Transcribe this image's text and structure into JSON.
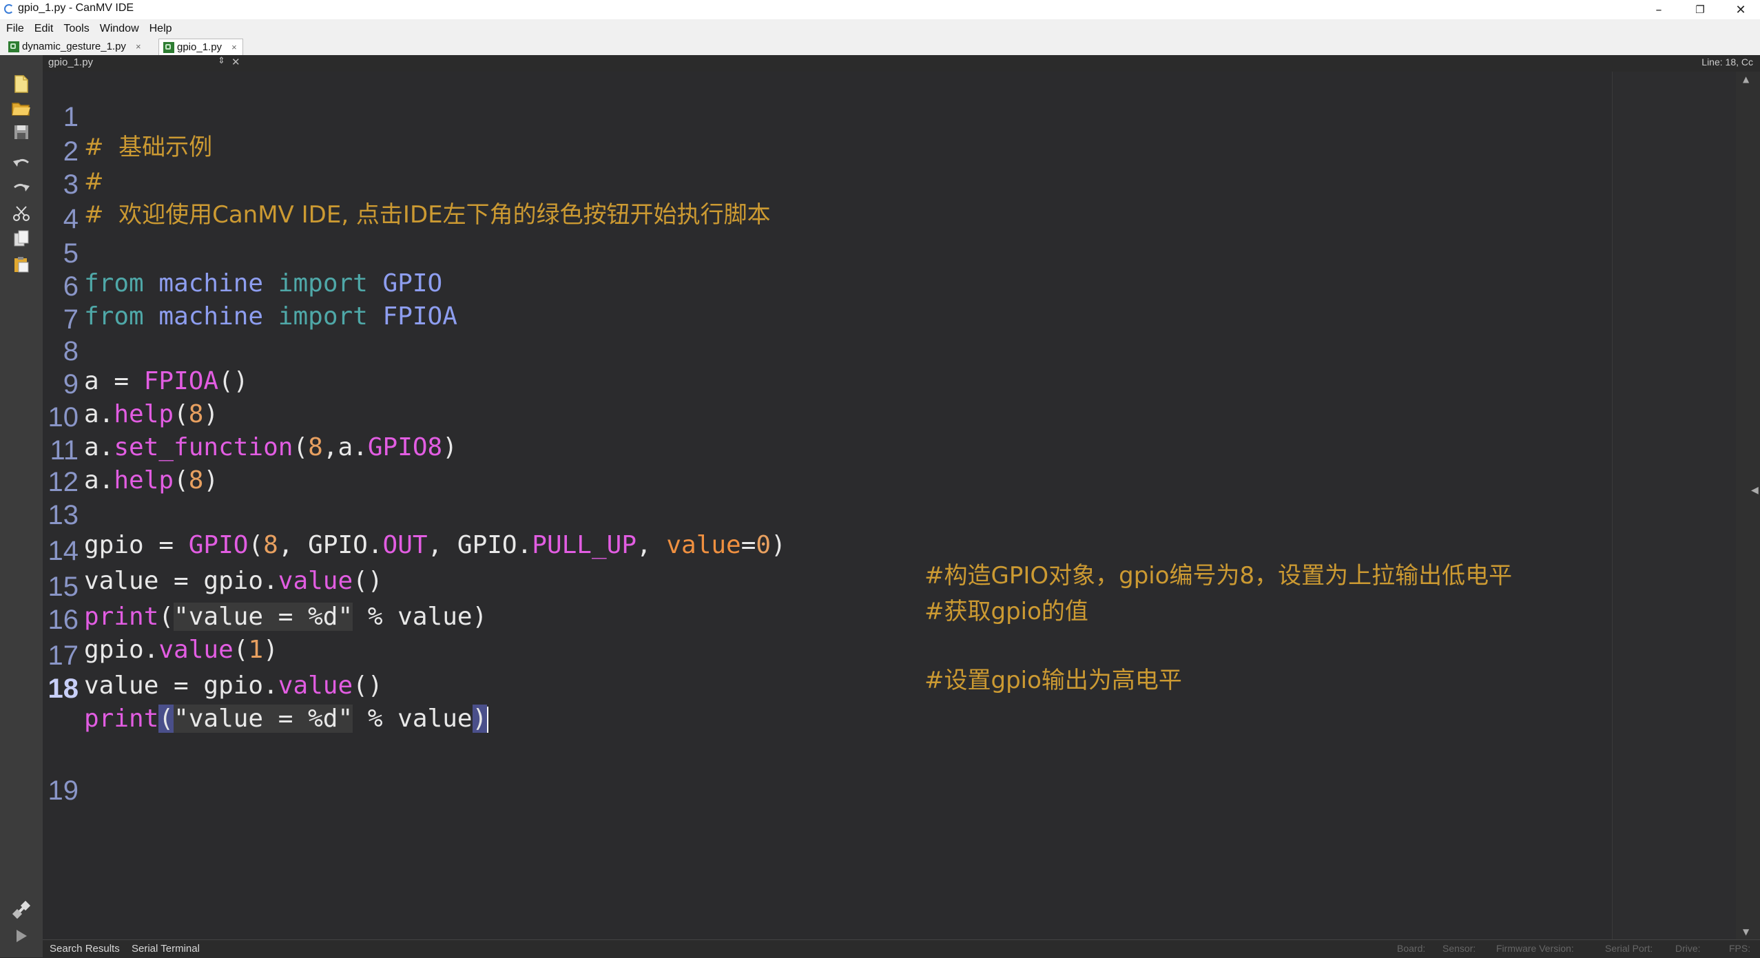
{
  "window": {
    "title": "gpio_1.py - CanMV IDE",
    "minimize": "–",
    "restore": "❐",
    "close": "✕"
  },
  "menu": [
    "File",
    "Edit",
    "Tools",
    "Window",
    "Help"
  ],
  "tabs": [
    {
      "label": "dynamic_gesture_1.py",
      "close": "×"
    },
    {
      "label": "gpio_1.py",
      "close": "×"
    }
  ],
  "file_bar": {
    "filename": "gpio_1.py",
    "position": "Line: 18, Cc"
  },
  "toolbar_icons": [
    "new-file-icon",
    "open-folder-icon",
    "save-icon",
    "undo-icon",
    "redo-icon",
    "cut-icon",
    "copy-icon",
    "paste-icon"
  ],
  "bottom_icons": [
    "connect-icon",
    "run-icon"
  ],
  "code": {
    "line_numbers": [
      "1",
      "2",
      "3",
      "4",
      "5",
      "6",
      "7",
      "8",
      "9",
      "10",
      "11",
      "12",
      "13",
      "14",
      "15",
      "16",
      "17",
      "18",
      "19"
    ],
    "current_line": "18",
    "l1": "#  基础示例",
    "l2": "#",
    "l3": "#  欢迎使用CanMV IDE, 点击IDE左下角的绿色按钮开始执行脚本",
    "l5": {
      "from": "from",
      "module": "machine",
      "import": "import",
      "name": "GPIO"
    },
    "l6": {
      "from": "from",
      "module": "machine",
      "import": "import",
      "name": "FPIOA"
    },
    "l8": {
      "var": "a",
      "eq": " = ",
      "fn": "FPIOA",
      "rest": "()"
    },
    "l9": {
      "obj": "a.",
      "fn": "help",
      "open": "(",
      "num": "8",
      "close": ")"
    },
    "l10": {
      "obj": "a.",
      "fn": "set_function",
      "open": "(",
      "num": "8",
      "mid": ",a.",
      "attr": "GPIO8",
      "close": ")"
    },
    "l11": {
      "obj": "a.",
      "fn": "help",
      "open": "(",
      "num": "8",
      "close": ")"
    },
    "l13": {
      "var": "gpio",
      "eq": " = ",
      "fn": "GPIO",
      "open": "(",
      "num": "8",
      "c1": ", GPIO.",
      "a1": "OUT",
      "c2": ", GPIO.",
      "a2": "PULL_UP",
      "c3": ", ",
      "kw": "value",
      "eq2": "=",
      "num2": "0",
      "close": ")"
    },
    "l13_comment": "#构造GPIO对象，gpio编号为8，设置为上拉输出低电平",
    "l14": {
      "var": "value",
      "eq": " = ",
      "obj": "gpio.",
      "fn": "value",
      "rest": "()"
    },
    "l14_comment": "#获取gpio的值",
    "l15": {
      "fn": "print",
      "open": "(",
      "str": "\"value = %d\"",
      "rest": " % value)"
    },
    "l16": {
      "obj": "gpio.",
      "fn": "value",
      "open": "(",
      "num": "1",
      "close": ")"
    },
    "l16_comment": "#设置gpio输出为高电平",
    "l17": {
      "var": "value",
      "eq": " = ",
      "obj": "gpio.",
      "fn": "value",
      "rest": "()"
    },
    "l18": {
      "fn": "print",
      "open": "(",
      "str": "\"value = %d\"",
      "rest": " % value",
      "close": ")"
    }
  },
  "bottom_tabs": [
    "Search Results",
    "Serial Terminal"
  ],
  "status": {
    "board": "Board:",
    "sensor": "Sensor:",
    "firmware": "Firmware Version:",
    "serial": "Serial Port:",
    "drive": "Drive:",
    "fps": "FPS:"
  }
}
